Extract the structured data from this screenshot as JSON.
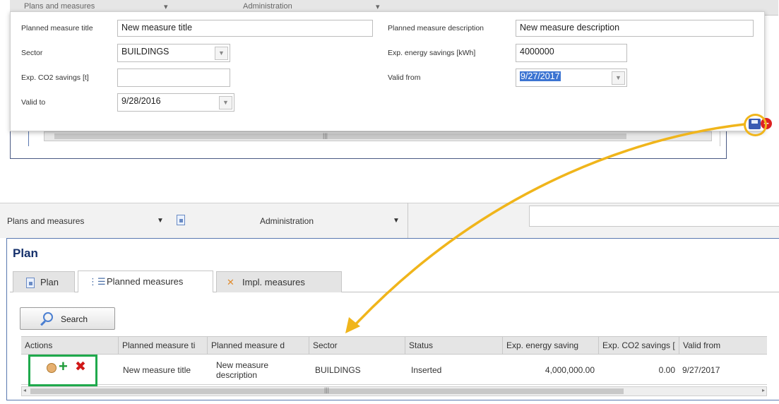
{
  "top_strip": {
    "menu1": "Plans and measures",
    "menu2": "Administration"
  },
  "popup": {
    "title_label": "Planned measure title",
    "title_value": "New measure title",
    "desc_label": "Planned measure description",
    "desc_value": "New measure description",
    "sector_label": "Sector",
    "sector_value": "BUILDINGS",
    "energy_label": "Exp. energy savings [kWh]",
    "energy_value": "4000000",
    "co2_label": "Exp. CO2 savings [t]",
    "co2_value": "",
    "valid_from_label": "Valid from",
    "valid_from_value": "9/27/2017",
    "valid_to_label": "Valid to",
    "valid_to_value": "9/28/2016"
  },
  "nav": {
    "menu1": "Plans and measures",
    "menu2": "Administration"
  },
  "page": {
    "title": "Plan"
  },
  "tabs": [
    {
      "label": "Plan"
    },
    {
      "label": "Planned measures"
    },
    {
      "label": "Impl. measures"
    }
  ],
  "search_button": "Search",
  "grid": {
    "headers": [
      "Actions",
      "Planned measure ti",
      "Planned measure d",
      "Sector",
      "Status",
      "Exp. energy saving",
      "Exp. CO2 savings [",
      "Valid from"
    ],
    "row": {
      "title": "New measure title",
      "description_line1": "New measure",
      "description_line2": "description",
      "sector": "BUILDINGS",
      "status": "Inserted",
      "energy": "4,000,000.00",
      "co2": "0.00",
      "valid_from": "9/27/2017"
    }
  },
  "colors": {
    "accent_arrow": "#f0b51b",
    "highlight_box": "#1fa94c",
    "title_blue": "#15306b"
  }
}
